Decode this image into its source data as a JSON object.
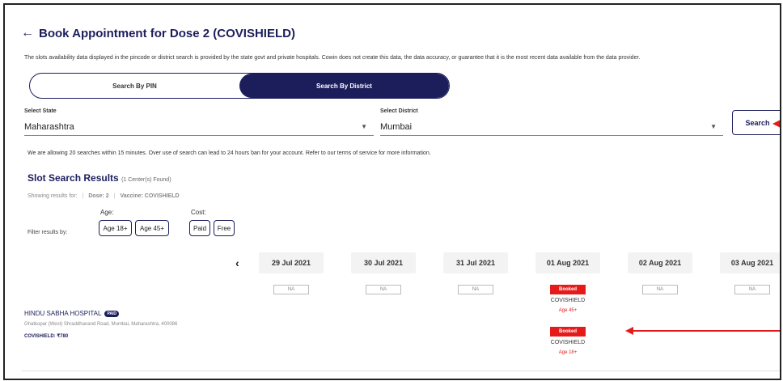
{
  "header": {
    "back_icon": "←",
    "title": "Book Appointment for Dose 2 (COVISHIELD)"
  },
  "disclaimer": "The slots availability data displayed in the pincode or district search is provided by the state govt and private hospitals. Cowin does not create this data, the data accuracy, or guarantee that it is the most recent data available from the data provider.",
  "search_tabs": {
    "pin_label": "Search By PIN",
    "district_label": "Search By District",
    "active": "district"
  },
  "state": {
    "label": "Select State",
    "value": "Maharashtra"
  },
  "district": {
    "label": "Select District",
    "value": "Mumbai"
  },
  "search_button": "Search",
  "rate_limit_note": "We are allowing 20 searches within 15 minutes. Over use of search can lead to 24 hours ban for your account. Refer to our terms of service for more information.",
  "results": {
    "title": "Slot Search Results",
    "count_text": "(1 Center(s) Found)",
    "showing_label": "Showing results for:",
    "dose": "Dose: 2",
    "vaccine": "Vaccine: COVISHIELD"
  },
  "filters": {
    "label": "Filter results by:",
    "age_heading": "Age:",
    "cost_heading": "Cost:",
    "age_18": "Age 18+",
    "age_45": "Age 45+",
    "paid": "Paid",
    "free": "Free"
  },
  "dates": [
    "29 Jul 2021",
    "30 Jul 2021",
    "31 Jul 2021",
    "01 Aug 2021",
    "02 Aug 2021",
    "03 Aug 2021"
  ],
  "prev_icon": "‹",
  "center": {
    "name": "HINDU SABHA HOSPITAL",
    "badge": "PAID",
    "address": "Ghatkopar (West) Shraddhanand Road, Mumbai, Maharashtra, 400086",
    "price": "COVISHIELD: ₹780",
    "slots": {
      "na_text": "NA",
      "booked_text": "Booked",
      "vaccine": "COVISHIELD",
      "age_45": "Age 45+",
      "age_18": "Age 18+"
    }
  },
  "colors": {
    "primary": "#1c1e5c",
    "booked": "#e51b1b",
    "annotation_arrow": "#e51b1b"
  }
}
